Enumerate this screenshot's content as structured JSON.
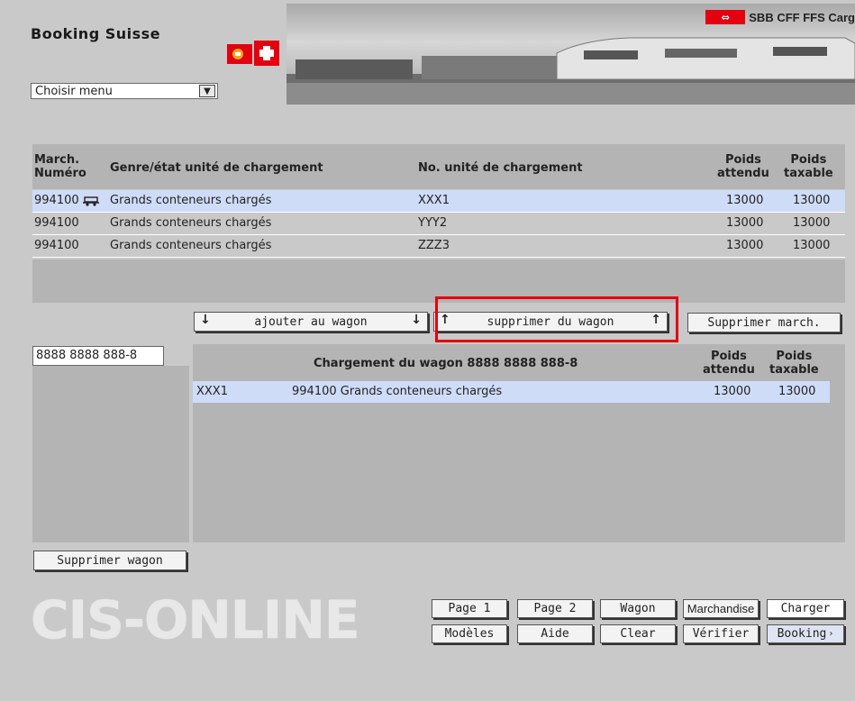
{
  "app": {
    "title": "Booking Suisse",
    "brand": "SBB CFF FFS Carg",
    "watermark": "CIS-ONLINE"
  },
  "menu": {
    "selected": "Choisir menu"
  },
  "shipment_table": {
    "headers": {
      "march_num": [
        "March.",
        "Numéro"
      ],
      "genre": "Genre/état unité de chargement",
      "unit_no": "No. unité de chargement",
      "poids_attendu": [
        "Poids",
        "attendu"
      ],
      "poids_taxable": [
        "Poids",
        "taxable"
      ]
    },
    "rows": [
      {
        "march": "994100",
        "genre": "Grands conteneurs chargés",
        "unit": "XXX1",
        "attendu": "13000",
        "taxable": "13000",
        "selected": true
      },
      {
        "march": "994100",
        "genre": "Grands conteneurs chargés",
        "unit": "YYY2",
        "attendu": "13000",
        "taxable": "13000",
        "selected": false
      },
      {
        "march": "994100",
        "genre": "Grands conteneurs chargés",
        "unit": "ZZZ3",
        "attendu": "13000",
        "taxable": "13000",
        "selected": false
      }
    ]
  },
  "actions": {
    "add": "ajouter au wagon",
    "remove": "supprimer du wagon",
    "delete_march": "Supprimer march."
  },
  "wagon": {
    "number_value": "8888 8888 888-8",
    "table_title": "Chargement du wagon 8888 8888 888-8",
    "poids_attendu": [
      "Poids",
      "attendu"
    ],
    "poids_taxable": [
      "Poids",
      "taxable"
    ],
    "rows": [
      {
        "unit": "XXX1",
        "desc": "994100 Grands conteneurs chargés",
        "attendu": "13000",
        "taxable": "13000"
      }
    ],
    "delete_wagon": "Supprimer wagon"
  },
  "nav": {
    "row1": [
      "Page 1",
      "Page 2",
      "Wagon",
      "Marchandise",
      "Charger"
    ],
    "row2": [
      "Modèles",
      "Aide",
      "Clear",
      "Vérifier",
      "Booking"
    ]
  },
  "colors": {
    "accent_red": "#e3000f",
    "selection": "#cfdcf8",
    "panel": "#b4b4b4",
    "background": "#c9c9c9"
  }
}
